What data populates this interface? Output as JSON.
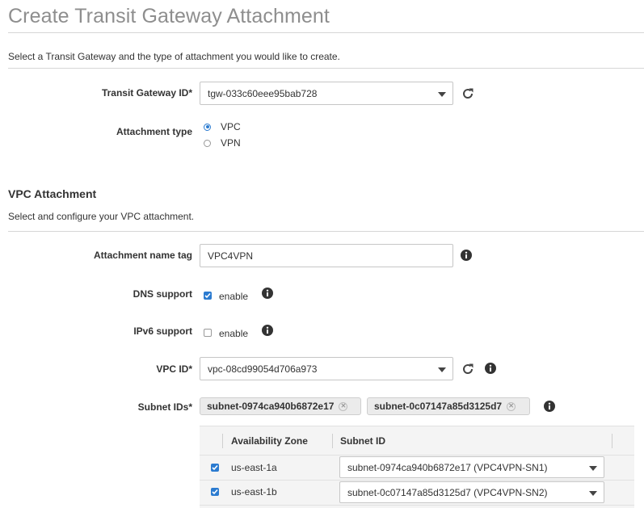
{
  "page": {
    "title": "Create Transit Gateway Attachment",
    "description": "Select a Transit Gateway and the type of attachment you would like to create."
  },
  "gateway": {
    "tgw_label": "Transit Gateway ID*",
    "tgw_value": "tgw-033c60eee95bab728",
    "attachment_type_label": "Attachment type",
    "options": [
      {
        "label": "VPC",
        "selected": true
      },
      {
        "label": "VPN",
        "selected": false
      }
    ]
  },
  "vpc_attachment": {
    "title": "VPC Attachment",
    "description": "Select and configure your VPC attachment.",
    "name_tag_label": "Attachment name tag",
    "name_tag_value": "VPC4VPN",
    "dns_label": "DNS support",
    "dns_checked": true,
    "dns_option": "enable",
    "ipv6_label": "IPv6 support",
    "ipv6_checked": false,
    "ipv6_option": "enable",
    "vpc_id_label": "VPC ID*",
    "vpc_id_value": "vpc-08cd99054d706a973",
    "subnet_ids_label": "Subnet IDs*",
    "subnet_tokens": [
      "subnet-0974ca940b6872e17",
      "subnet-0c07147a85d3125d7"
    ]
  },
  "subnet_table": {
    "headers": [
      "Availability Zone",
      "Subnet ID"
    ],
    "rows": [
      {
        "checked": true,
        "zone": "us-east-1a",
        "subnet": "subnet-0974ca940b6872e17 (VPC4VPN-SN1)"
      },
      {
        "checked": true,
        "zone": "us-east-1b",
        "subnet": "subnet-0c07147a85d3125d7 (VPC4VPN-SN2)"
      }
    ]
  },
  "colors": {
    "accent": "#2b7bd0",
    "title_gray": "#8e8e8e",
    "border": "#c6c6c6"
  }
}
